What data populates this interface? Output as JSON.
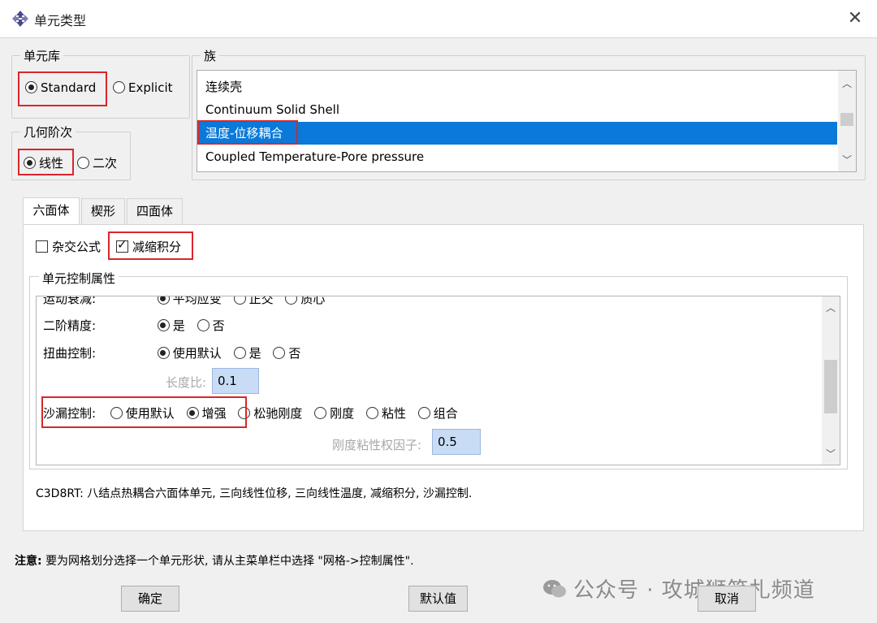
{
  "window": {
    "title": "单元类型",
    "close_glyph": "✕"
  },
  "element_library": {
    "legend": "单元库",
    "options": [
      "Standard",
      "Explicit"
    ],
    "selected": "Standard"
  },
  "geometric_order": {
    "legend": "几何阶次",
    "options": [
      "线性",
      "二次"
    ],
    "selected": "线性"
  },
  "family": {
    "legend": "族",
    "items": [
      "连续壳",
      "Continuum Solid Shell",
      "温度-位移耦合",
      "Coupled Temperature-Pore pressure"
    ],
    "selected": "温度-位移耦合"
  },
  "tabs": [
    "六面体",
    "楔形",
    "四面体"
  ],
  "active_tab": "六面体",
  "options": {
    "hybrid_label": "杂交公式",
    "hybrid_checked": false,
    "reduced_label": "减缩积分",
    "reduced_checked": true
  },
  "controls": {
    "legend": "单元控制属性",
    "partial_row": {
      "label": "运动衰减:",
      "options": [
        "平均应变",
        "正交",
        "质心"
      ]
    },
    "second_order": {
      "label": "二阶精度:",
      "options": [
        "是",
        "否"
      ],
      "selected": "是"
    },
    "distortion": {
      "label": "扭曲控制:",
      "options": [
        "使用默认",
        "是",
        "否"
      ],
      "selected": "使用默认"
    },
    "length_ratio": {
      "label": "长度比:",
      "value": "0.1"
    },
    "hourglass": {
      "label": "沙漏控制:",
      "options": [
        "使用默认",
        "增强",
        "松驰刚度",
        "刚度",
        "粘性",
        "组合"
      ],
      "selected": "增强"
    },
    "stiffness_viscosity": {
      "label": "刚度粘性权因子:",
      "value": "0.5"
    }
  },
  "description": "C3D8RT:  八结点热耦合六面体单元, 三向线性位移, 三向线性温度, 减缩积分, 沙漏控制.",
  "note": {
    "prefix": "注意:",
    "text": "要为网格划分选择一个单元形状, 请从主菜单栏中选择 \"网格->控制属性\"."
  },
  "buttons": {
    "ok": "确定",
    "defaults": "默认值",
    "cancel": "取消"
  },
  "watermark": "公众号 · 攻城狮笔札频道",
  "colors": {
    "selection": "#0a79d9",
    "highlight_box": "#d9262b",
    "textbox": "#c8dcf6"
  }
}
